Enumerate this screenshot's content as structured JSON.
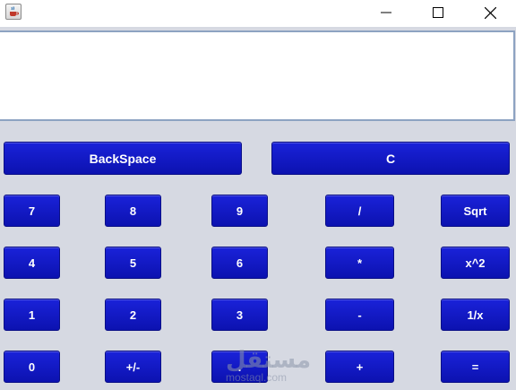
{
  "window": {
    "icons": {
      "app": "java-cup-icon",
      "minimize": "minimize-icon",
      "maximize": "maximize-icon",
      "close": "close-icon"
    }
  },
  "display": {
    "value": ""
  },
  "buttons": {
    "backspace": "BackSpace",
    "clear": "C",
    "seven": "7",
    "eight": "8",
    "nine": "9",
    "divide": "/",
    "sqrt": "Sqrt",
    "four": "4",
    "five": "5",
    "six": "6",
    "multiply": "*",
    "square": "x^2",
    "one": "1",
    "two": "2",
    "three": "3",
    "subtract": "-",
    "reciprocal": "1/x",
    "zero": "0",
    "negate": "+/-",
    "decimal": ".",
    "add": "+",
    "equals": "="
  },
  "watermark": {
    "arabic": "مستقل",
    "latin": "mostaql.com"
  },
  "colors": {
    "button": "#1418c8",
    "background": "#d6d9e2",
    "display_border": "#8da3c2"
  }
}
